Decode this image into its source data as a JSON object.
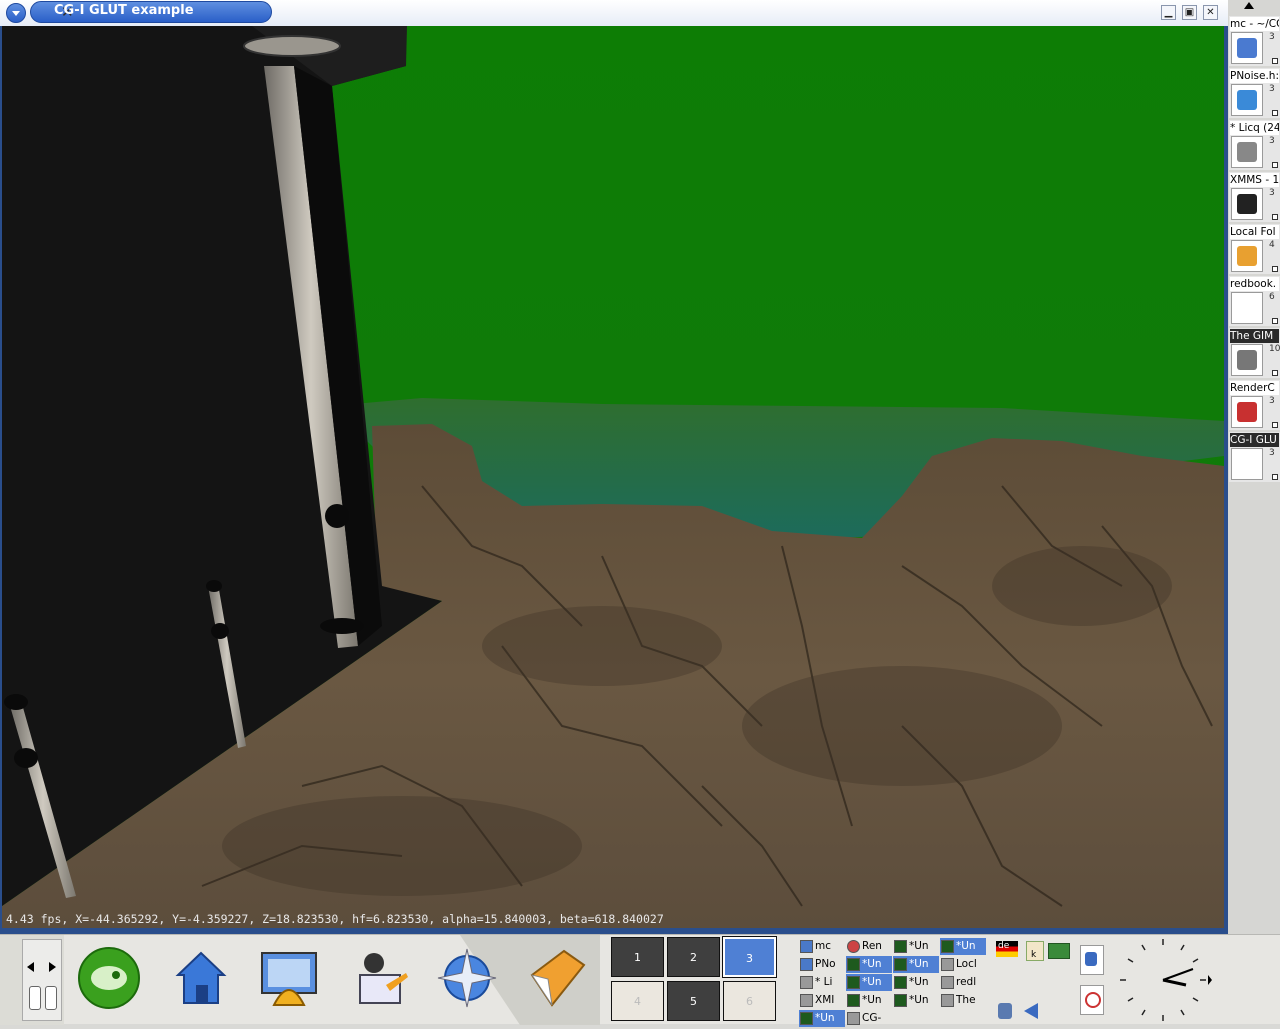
{
  "window": {
    "title": "CG-I GLUT example",
    "icon": "x-window-icon",
    "buttons": {
      "minimize": "minimize-icon",
      "maximize": "maximize-icon",
      "close": "close-icon"
    }
  },
  "scene": {
    "description_colors": {
      "sky": "#0f7f08",
      "water": "#1f6f57",
      "ground": "#6b5843",
      "building": "#151515"
    },
    "status": "4.43 fps,  X=-44.365292, Y=-4.359227, Z=18.823530, hf=6.823530, alpha=15.840003, beta=618.840027"
  },
  "right_taskbar": {
    "items": [
      {
        "title": "mc - ~/CG",
        "count": "3",
        "icon": "konqueror-shell-icon",
        "active": false
      },
      {
        "title": "PNoise.h:",
        "count": "3",
        "icon": "kwrite-icon",
        "active": false
      },
      {
        "title": "* Licq (24",
        "count": "3",
        "icon": "computer-icon",
        "active": false
      },
      {
        "title": "XMMS - 1",
        "count": "3",
        "icon": "xmms-icon",
        "active": false
      },
      {
        "title": "Local Fol",
        "count": "4",
        "icon": "kmail-folder-icon",
        "active": false
      },
      {
        "title": "redbook.",
        "count": "6",
        "icon": "document-icon",
        "active": false
      },
      {
        "title": "The GIM",
        "count": "10",
        "icon": "gimp-icon",
        "active": true
      },
      {
        "title": "RenderC",
        "count": "3",
        "icon": "renderer-icon",
        "active": false
      },
      {
        "title": "CG-I GLU",
        "count": "3",
        "icon": "x-window-icon",
        "active": true
      }
    ]
  },
  "panel": {
    "launchers": [
      "suse-menu-icon",
      "home-folder-icon",
      "control-center-icon",
      "personal-settings-icon",
      "konqueror-web-icon",
      "kmail-icon"
    ],
    "desktops": [
      {
        "label": "1",
        "state": "dark"
      },
      {
        "label": "2",
        "state": "dark"
      },
      {
        "label": "3",
        "state": "current"
      },
      {
        "label": "4",
        "state": "light"
      },
      {
        "label": "5",
        "state": "dark"
      },
      {
        "label": "6",
        "state": "light"
      }
    ],
    "tasks": [
      {
        "label": "mc",
        "icon": "blue",
        "active": false
      },
      {
        "label": "Ren",
        "icon": "red",
        "active": false
      },
      {
        "label": "*Un",
        "icon": "green",
        "active": false
      },
      {
        "label": "*Un",
        "icon": "green",
        "active": true
      },
      {
        "label": "PNo",
        "icon": "blue",
        "active": false
      },
      {
        "label": "*Un",
        "icon": "green",
        "active": true
      },
      {
        "label": "*Un",
        "icon": "green",
        "active": true
      },
      {
        "label": "Locl",
        "icon": "gray",
        "active": false
      },
      {
        "label": "* Li",
        "icon": "gray",
        "active": false
      },
      {
        "label": "*Un",
        "icon": "green",
        "active": true
      },
      {
        "label": "*Un",
        "icon": "green",
        "active": false
      },
      {
        "label": "redl",
        "icon": "gray",
        "active": false
      },
      {
        "label": "XMI",
        "icon": "gray",
        "active": false
      },
      {
        "label": "*Un",
        "icon": "green",
        "active": false
      },
      {
        "label": "*Un",
        "icon": "green",
        "active": false
      },
      {
        "label": "The",
        "icon": "gray",
        "active": false
      },
      {
        "label": "*Un",
        "icon": "green",
        "active": true
      },
      {
        "label": "CG-",
        "icon": "gray",
        "active": false
      }
    ],
    "tray": {
      "language": "de",
      "k_label": "k"
    },
    "clock_icon": "analog-clock"
  }
}
